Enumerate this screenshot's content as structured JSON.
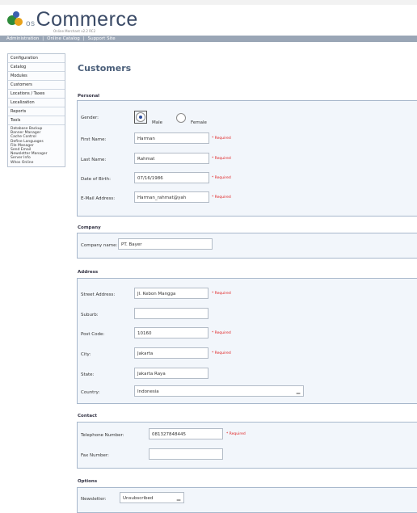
{
  "app": {
    "logo_text": "Commerce",
    "logo_prefix": "os",
    "logo_subtitle": "Online Merchant v2.2 RC2"
  },
  "topnav": {
    "items": [
      "Administration",
      "|",
      "Online Catalog",
      "|",
      "Support Site"
    ]
  },
  "sidebar": {
    "items": [
      "Configuration",
      "Catalog",
      "Modules",
      "Customers",
      "Locations / Taxes",
      "Localization",
      "Reports",
      "Tools"
    ],
    "tools": [
      "Database Backup",
      "Banner Manager",
      "Cache Control",
      "Define Languages",
      "File Manager",
      "Send Email",
      "Newsletter Manager",
      "Server Info",
      "Whos Online"
    ]
  },
  "page": {
    "title": "Customers"
  },
  "required_text": "* Required",
  "personal": {
    "title": "Personal",
    "gender_label": "Gender:",
    "male_label": "Male",
    "female_label": "Female",
    "gender_selected": "Male",
    "first_name_label": "First Name:",
    "first_name_value": "Harman",
    "last_name_label": "Last Name:",
    "last_name_value": "Rahmat",
    "dob_label": "Date of Birth:",
    "dob_value": "07/16/1986",
    "email_label": "E-Mail Address:",
    "email_value": "Harman_rahmat@yah"
  },
  "company": {
    "title": "Company",
    "name_label": "Company name:",
    "name_value": "PT. Bayer"
  },
  "address": {
    "title": "Address",
    "street_label": "Street Address:",
    "street_value": "Jl. Kebon Mangga",
    "suburb_label": "Suburb:",
    "suburb_value": "",
    "postcode_label": "Post Code:",
    "postcode_value": "10160",
    "city_label": "City:",
    "city_value": "Jakarta",
    "state_label": "State:",
    "state_value": "Jakarta Raya",
    "country_label": "Country:",
    "country_value": "Indonesia"
  },
  "contact": {
    "title": "Contact",
    "phone_label": "Telephone Number:",
    "phone_value": "081327848445",
    "fax_label": "Fax Number:",
    "fax_value": ""
  },
  "options": {
    "title": "Options",
    "newsletter_label": "Newsletter:",
    "newsletter_value": "Unsubscribed"
  },
  "colors": {
    "required": "#e02020",
    "panel_bg": "#f2f6fb",
    "panel_border": "#a8b8cc",
    "title": "#4b5f7a",
    "nav_bg": "#9aa6b6"
  },
  "icons": {
    "logo": "oscommerce-logo-icon",
    "select_arrow": "chevron-down-icon"
  }
}
